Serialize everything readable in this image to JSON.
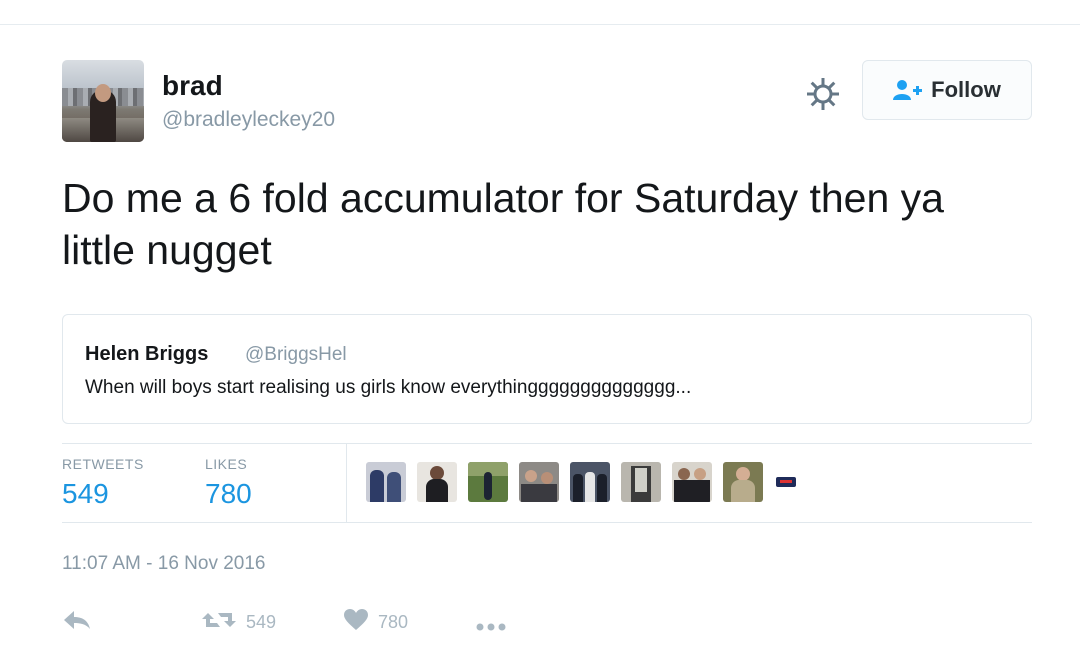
{
  "tweet": {
    "author": {
      "name": "brad",
      "handle": "@bradleyleckey20"
    },
    "follow_label": "Follow",
    "text": "Do me a 6 fold accumulator for Saturday then ya little nugget",
    "quoted": {
      "name": "Helen Briggs",
      "handle": "@BriggsHel",
      "text": "When will boys start realising us girls know everythingggggggggggggg..."
    },
    "stats": {
      "retweets_label": "RETWEETS",
      "retweets_value": "549",
      "likes_label": "LIKES",
      "likes_value": "780"
    },
    "timestamp": "11:07 AM - 16 Nov 2016",
    "actions": {
      "retweet_count": "549",
      "like_count": "780"
    }
  },
  "icons": [
    "gear-icon",
    "follow-person-icon",
    "reply-icon",
    "retweet-icon",
    "heart-icon",
    "more-icon"
  ],
  "colors": {
    "link_blue": "#1b95e0",
    "secondary_text": "#8899a6",
    "action_gray": "#aab8c2",
    "border": "#e1e8ed",
    "follow_icon_blue": "#1da1f2"
  }
}
